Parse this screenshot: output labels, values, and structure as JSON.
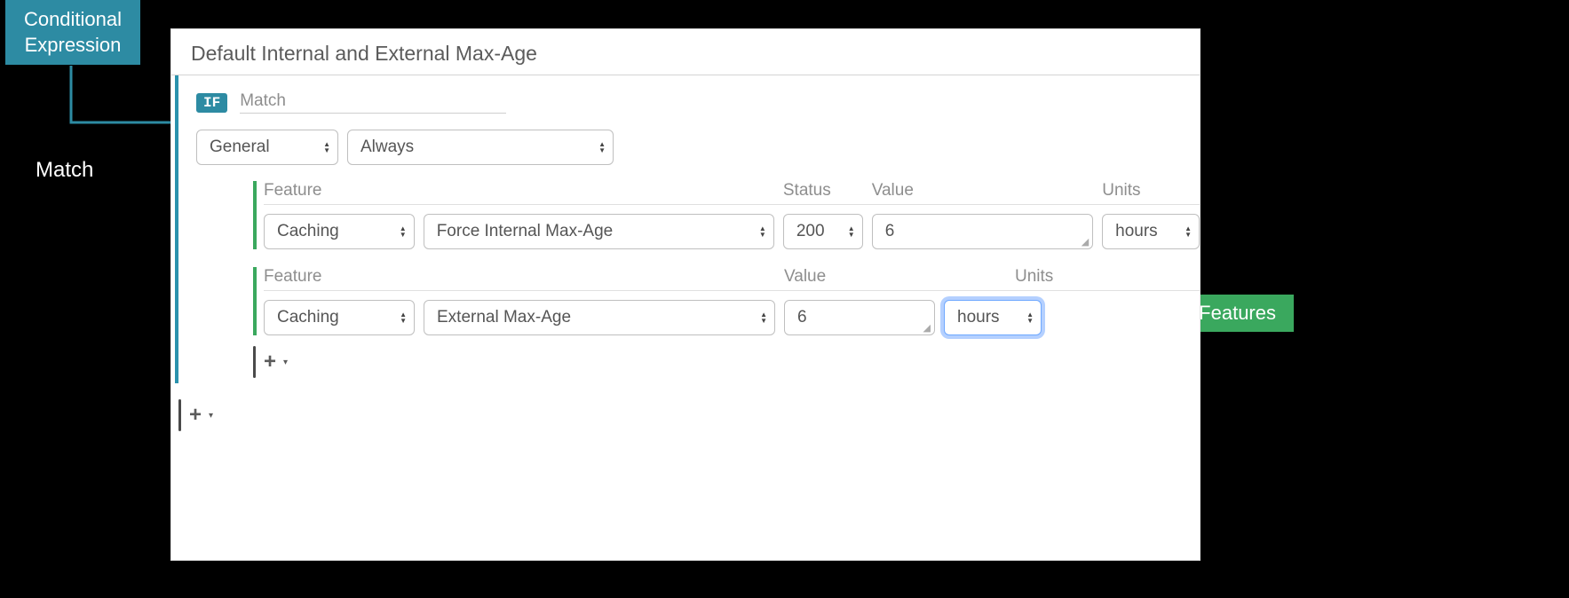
{
  "callouts": {
    "conditional_line1": "Conditional",
    "conditional_line2": "Expression",
    "match": "Match",
    "features": "Features"
  },
  "rule": {
    "title": "Default Internal and External Max-Age",
    "if_badge": "IF",
    "if_label": "Match",
    "match": {
      "category": "General",
      "condition": "Always"
    },
    "features": [
      {
        "labels": {
          "feature": "Feature",
          "status": "Status",
          "value": "Value",
          "units": "Units"
        },
        "category": "Caching",
        "name": "Force Internal Max-Age",
        "status": "200",
        "value": "6",
        "units": "hours",
        "has_status": true,
        "units_focused": false
      },
      {
        "labels": {
          "feature": "Feature",
          "value": "Value",
          "units": "Units"
        },
        "category": "Caching",
        "name": "External Max-Age",
        "value": "6",
        "units": "hours",
        "has_status": false,
        "units_focused": true
      }
    ],
    "add_label": "+",
    "add_dd": "▾"
  }
}
